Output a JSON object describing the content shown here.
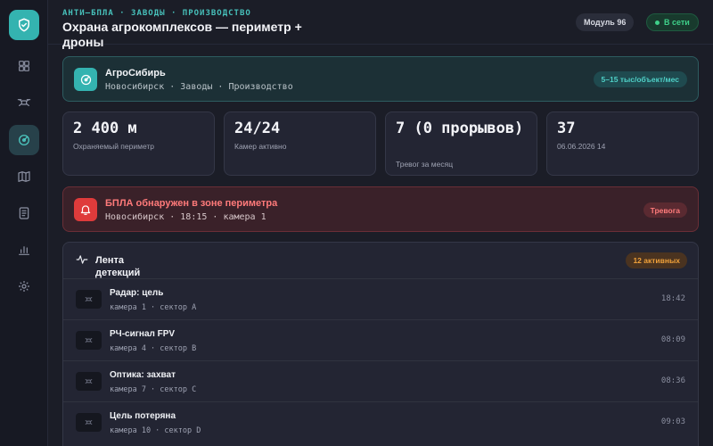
{
  "sidebar": {
    "logo_icon": "shield-check-icon",
    "items": [
      {
        "name": "dashboard",
        "icon": "grid-icon"
      },
      {
        "name": "drone",
        "icon": "drone-icon"
      },
      {
        "name": "radar",
        "icon": "radar-icon",
        "active": true
      },
      {
        "name": "map",
        "icon": "map-icon"
      },
      {
        "name": "reports",
        "icon": "document-icon"
      },
      {
        "name": "analytics",
        "icon": "bar-chart-icon"
      },
      {
        "name": "settings",
        "icon": "gear-icon"
      }
    ]
  },
  "header": {
    "breadcrumb": "АНТИ–БПЛА · ЗАВОДЫ · ПРОИЗВОДСТВО",
    "title": "Охрана агрокомплексов — периметр + дроны",
    "module": "Модуль 96",
    "status": "В сети"
  },
  "client": {
    "name": "АгроСибирь",
    "subtitle": "Новосибирск · Заводы · Производство",
    "price": "5–15 тыс/объект/мес"
  },
  "stats": [
    {
      "value": "2 400 м",
      "label": "Охраняемый периметр"
    },
    {
      "value": "24/24",
      "label": "Камер активно"
    },
    {
      "value": "7 (0 прорывов)",
      "label": "Тревог за месяц"
    },
    {
      "value": "37",
      "label": "06.06.2026 14"
    }
  ],
  "alert": {
    "title": "БПЛА обнаружен в зоне периметра",
    "subtitle": "Новосибирск · 18:15 · камера 1",
    "badge": "Тревога"
  },
  "feed": {
    "title": "Лента детекций",
    "badge": "12 активных",
    "rows": [
      {
        "title": "Радар: цель",
        "sub": "камера 1 · сектор A",
        "time": "18:42"
      },
      {
        "title": "РЧ-сигнал FPV",
        "sub": "камера 4 · сектор B",
        "time": "08:09"
      },
      {
        "title": "Оптика: захват",
        "sub": "камера 7 · сектор C",
        "time": "08:36"
      },
      {
        "title": "Цель потеряна",
        "sub": "камера 10 · сектор D",
        "time": "09:03"
      }
    ]
  },
  "colors": {
    "accent": "#34b3b0",
    "danger": "#df3b3b",
    "warning": "#f0a13a",
    "success": "#3fd18a"
  }
}
